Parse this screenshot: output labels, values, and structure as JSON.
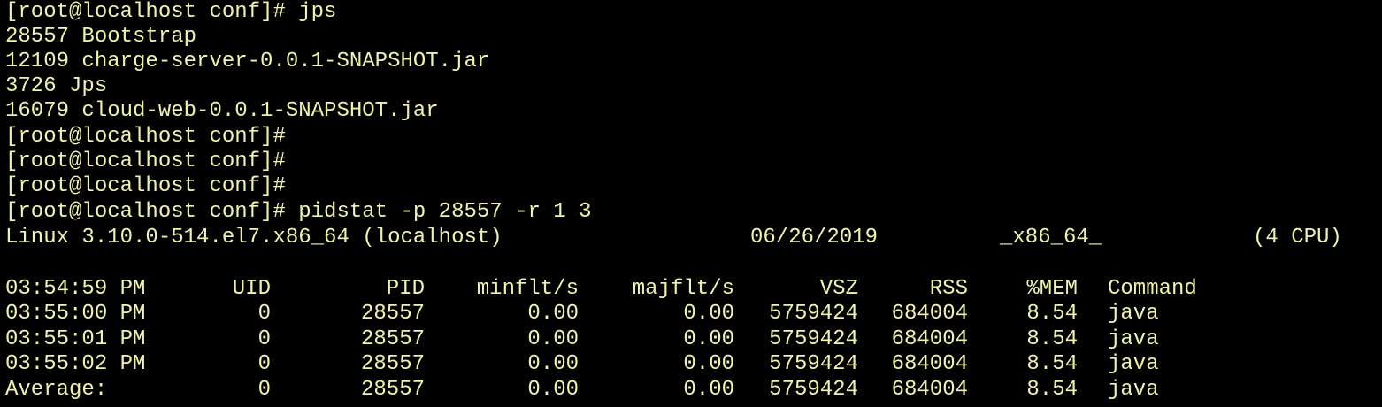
{
  "terminal": {
    "prompt": "[root@localhost conf]#",
    "lines": [
      "[root@localhost conf]# jps",
      "28557 Bootstrap",
      "12109 charge-server-0.0.1-SNAPSHOT.jar",
      "3726 Jps",
      "16079 cloud-web-0.0.1-SNAPSHOT.jar",
      "[root@localhost conf]#",
      "[root@localhost conf]#",
      "[root@localhost conf]#",
      "[root@localhost conf]# pidstat -p 28557 -r 1 3"
    ],
    "sysinfo": {
      "kernel": "Linux 3.10.0-514.el7.x86_64 (localhost)",
      "date": "06/26/2019",
      "arch": "_x86_64_",
      "cpu": "(4 CPU)"
    },
    "pidstat": {
      "header": [
        "03:54:59 PM",
        "UID",
        "PID",
        "minflt/s",
        "majflt/s",
        "VSZ",
        "RSS",
        "%MEM",
        "Command"
      ],
      "rows": [
        [
          "03:55:00 PM",
          "0",
          "28557",
          "0.00",
          "0.00",
          "5759424",
          "684004",
          "8.54",
          "java"
        ],
        [
          "03:55:01 PM",
          "0",
          "28557",
          "0.00",
          "0.00",
          "5759424",
          "684004",
          "8.54",
          "java"
        ],
        [
          "03:55:02 PM",
          "0",
          "28557",
          "0.00",
          "0.00",
          "5759424",
          "684004",
          "8.54",
          "java"
        ],
        [
          "Average:",
          "0",
          "28557",
          "0.00",
          "0.00",
          "5759424",
          "684004",
          "8.54",
          "java"
        ]
      ]
    }
  }
}
